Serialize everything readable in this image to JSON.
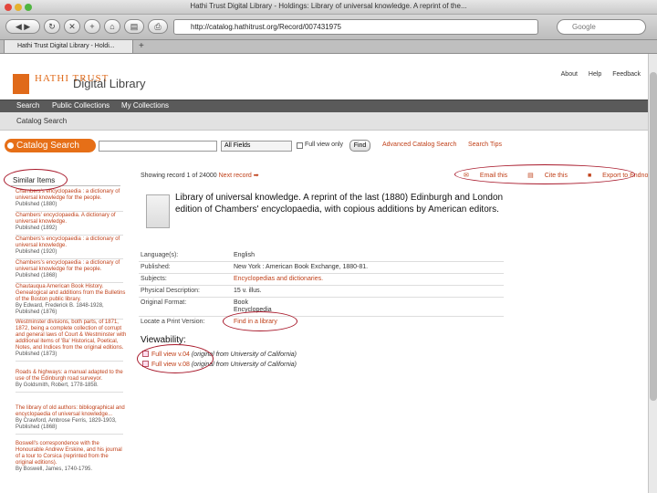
{
  "window": {
    "title": "Hathi Trust Digital Library - Holdings: Library of universal knowledge. A reprint of the...",
    "url": "http://catalog.hathitrust.org/Record/007431975",
    "search_placeholder": "Google",
    "tab_label": "Hathi Trust Digital Library - Holdi..."
  },
  "header": {
    "logo": "HATHI TRUST",
    "site_name": "Digital Library",
    "links": [
      "About",
      "Help",
      "Feedback"
    ]
  },
  "nav": [
    "Search",
    "Public Collections",
    "My Collections"
  ],
  "subnav": "Catalog Search",
  "search": {
    "button": "Catalog Search",
    "field": "All Fields",
    "full_view_label": "Full view only",
    "find": "Find",
    "advanced": "Advanced Catalog Search",
    "tips": "Search Tips"
  },
  "similar": {
    "heading": "Similar Items",
    "items": [
      {
        "title": "Chambers's encyclopaedia : a dictionary of universal knowledge for the people.",
        "meta": "Published (1880)"
      },
      {
        "title": "Chambers' encyclopaedia. A dictionary of universal knowledge.",
        "meta": "Published (1892)"
      },
      {
        "title": "Chambers's encyclopaedia : a dictionary of universal knowledge.",
        "meta": "Published (1920)"
      },
      {
        "title": "Chambers's encyclopaedia : a dictionary of universal knowledge for the people.",
        "meta": "Published (1868)"
      },
      {
        "title": "Chautauqua American Book History. Genealogical and additions from the Bulletins of the Boston public library.",
        "meta": "By Edward, Frederick B. 1848-1928, Published (1876)"
      },
      {
        "title": "Westminster divisions, both parts, of 1871, 1872, being a complete collection of corrupt and general laws of Court & Westminster with additional items of 'Ba' Historical, Poetical, Notes, and Indices from the original editions.",
        "meta": "Published (1873)"
      },
      {
        "title": "Roads & highways: a manual adapted to the use of the Edinburgh road surveyor.",
        "meta": "By Goldsmith, Robert, 1778-1858."
      },
      {
        "title": "The library of old authors: bibliographical and encyclopaedia of universal knowledge...",
        "meta": "By Crawford, Ambrose Ferris, 1829-1903, Published (1868)"
      },
      {
        "title": "Boswell's correspondence with the Honourable Andrew Erskine, and his journal of a tour to Corsica (reprinted from the original editions).",
        "meta": "By Boswell, James, 1740-1795."
      }
    ]
  },
  "record": {
    "showing": "Showing record 1 of 24000",
    "next": "Next record",
    "email": "Email this",
    "cite": "Cite this",
    "export": "Export to Endnote",
    "title": "Library of universal knowledge. A reprint of the last (1880) Edinburgh and London edition of Chambers' encyclopaedia, with copious additions by American editors.",
    "fields": [
      {
        "label": "Language(s):",
        "value": "English"
      },
      {
        "label": "Published:",
        "value": "New York : American Book Exchange, 1880-81."
      },
      {
        "label": "Subjects:",
        "value": "Encyclopedias and dictionaries."
      },
      {
        "label": "Physical Description:",
        "value": "15 v. illus."
      },
      {
        "label": "Original Format:",
        "value": "Book"
      },
      {
        "label": "",
        "value": "Encyclopedia"
      },
      {
        "label": "Locate a Print Version:",
        "value": "Find in a library"
      }
    ],
    "viewability_heading": "Viewability:",
    "views": [
      {
        "label": "Full view v.04",
        "source": "(original from University of California)"
      },
      {
        "label": "Full view v.08",
        "source": "(original from University of California)"
      }
    ]
  }
}
